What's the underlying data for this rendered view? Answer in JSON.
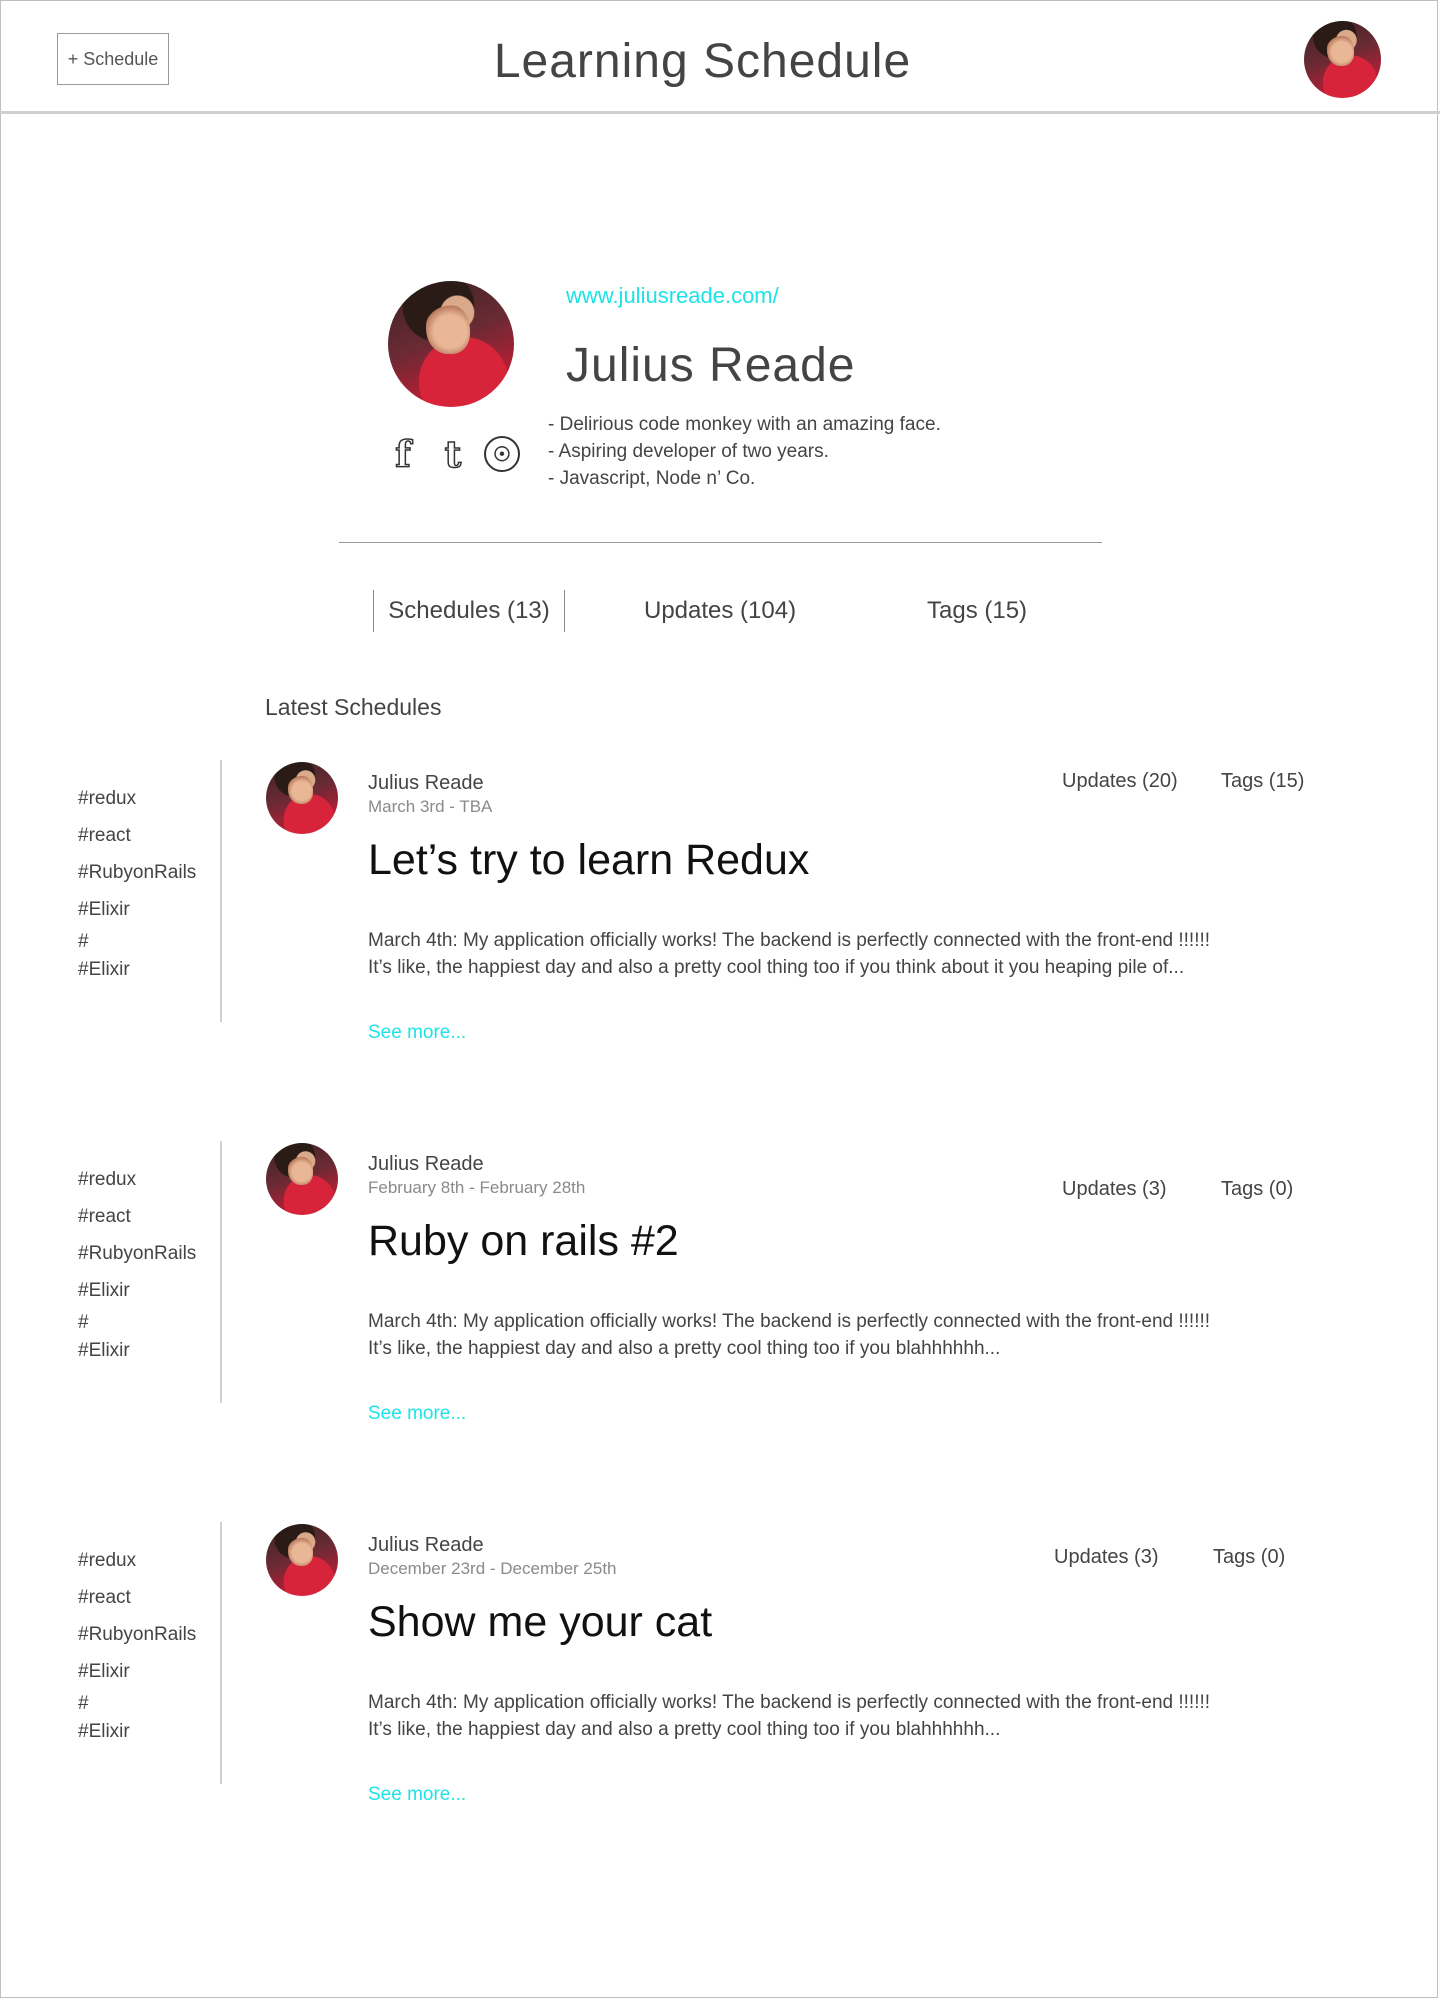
{
  "header": {
    "new_button": "+ Schedule",
    "title": "Learning Schedule"
  },
  "profile": {
    "link": "www.juliusreade.com/",
    "name": "Julius Reade",
    "bio": [
      "- Delirious code monkey with an amazing face.",
      "- Aspiring developer of two years.",
      "- Javascript, Node n’ Co."
    ],
    "socials": {
      "facebook": "f",
      "tumblr": "t",
      "github": "☉"
    }
  },
  "stats": {
    "schedules": "Schedules (13)",
    "updates": "Updates (104)",
    "tags": "Tags (15)"
  },
  "section_title": "Latest Schedules",
  "tag_list": [
    "#redux",
    "#react",
    "#RubyonRails",
    "#Elixir",
    "#",
    "#Elixir"
  ],
  "posts": [
    {
      "author": "Julius Reade",
      "date": "March 3rd - TBA",
      "updates": "Updates (20)",
      "tags": "Tags (15)",
      "title": "Let’s try to learn Redux",
      "excerpt_1": "March 4th: My application officially works! The backend is perfectly connected with the front-end !!!!!!",
      "excerpt_2": "It’s like, the happiest day and also a pretty cool thing too if you think about it you heaping pile of...",
      "see_more": "See more..."
    },
    {
      "author": "Julius Reade",
      "date": "February 8th - February 28th",
      "updates": "Updates (3)",
      "tags": "Tags (0)",
      "title": "Ruby on rails #2",
      "excerpt_1": "March 4th: My application officially works! The backend is perfectly connected with the front-end !!!!!!",
      "excerpt_2": "It’s like, the happiest day and also a pretty cool thing too if you blahhhhhh...",
      "see_more": "See more..."
    },
    {
      "author": "Julius Reade",
      "date": "December 23rd - December 25th",
      "updates": "Updates (3)",
      "tags": "Tags (0)",
      "title": "Show me your cat",
      "excerpt_1": "March 4th: My application officially works! The backend is perfectly connected with the front-end !!!!!!",
      "excerpt_2": "It’s like, the happiest day and also a pretty cool thing too if you blahhhhhh...",
      "see_more": "See more..."
    }
  ],
  "colors": {
    "accent": "#1de3e8",
    "text": "#444444",
    "muted": "#8a8a8a",
    "border": "#cfcfcf"
  }
}
